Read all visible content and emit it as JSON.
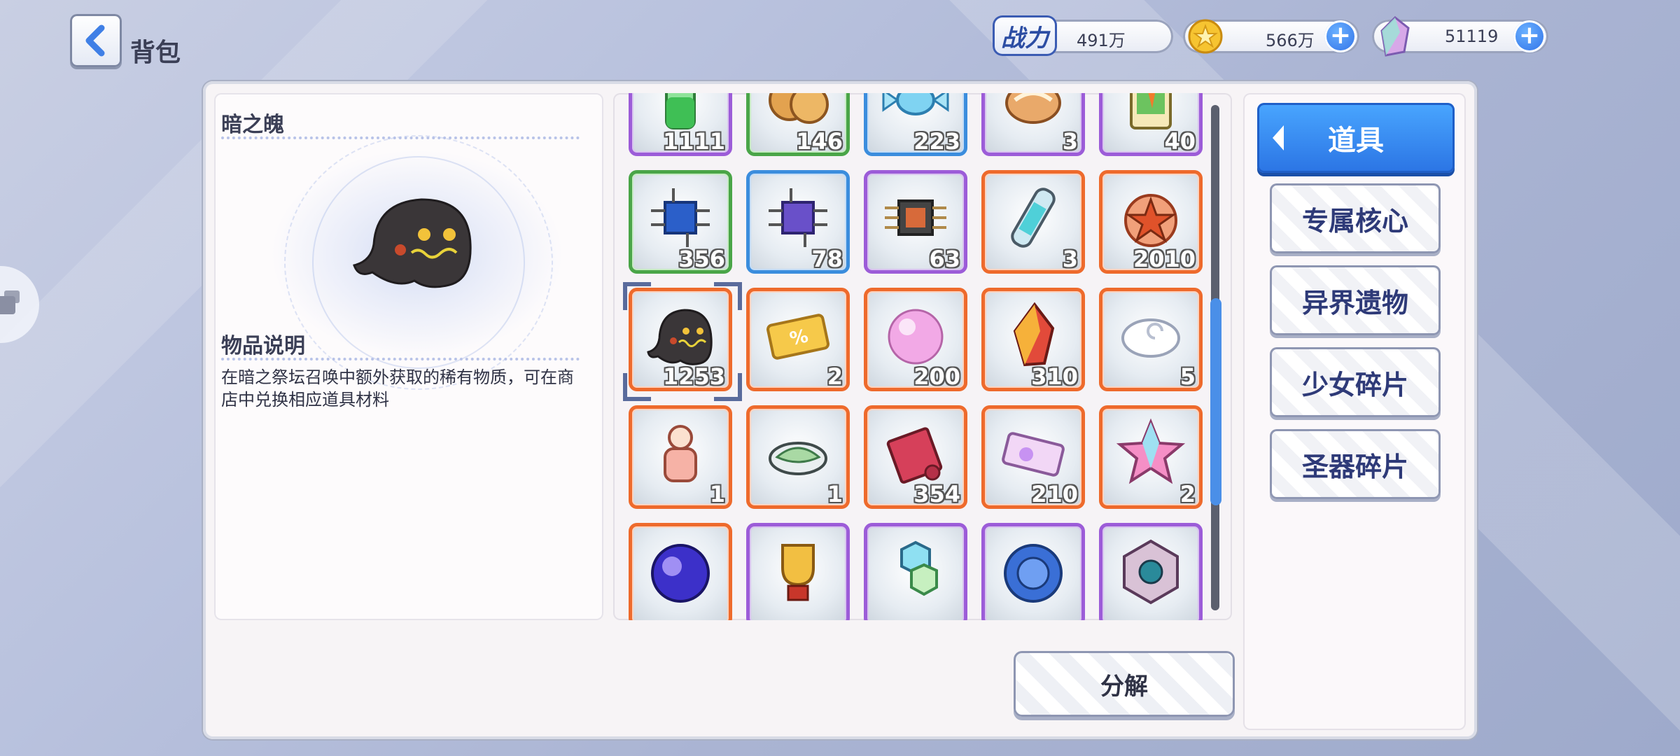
{
  "header": {
    "title": "背包"
  },
  "resources": {
    "power": {
      "label": "战力",
      "value": "491万"
    },
    "gold": {
      "value": "566万"
    },
    "crystal": {
      "value": "51119"
    }
  },
  "detail": {
    "item_name": "暗之魄",
    "section_title": "物品说明",
    "description": "在暗之祭坛召唤中额外获取的稀有物质，可在商店中兑换相应道具材料"
  },
  "items": [
    {
      "count": "1111",
      "rarity": "purple",
      "icon": "green-potion-icon"
    },
    {
      "count": "146",
      "rarity": "green",
      "icon": "cookies-icon"
    },
    {
      "count": "223",
      "rarity": "blue",
      "icon": "candy-icon"
    },
    {
      "count": "3",
      "rarity": "purple",
      "icon": "bread-roll-icon"
    },
    {
      "count": "40",
      "rarity": "purple",
      "icon": "juice-box-icon"
    },
    {
      "count": "356",
      "rarity": "green",
      "icon": "blue-chip-icon"
    },
    {
      "count": "78",
      "rarity": "blue",
      "icon": "purple-chip-icon"
    },
    {
      "count": "63",
      "rarity": "purple",
      "icon": "circuit-chip-icon"
    },
    {
      "count": "3",
      "rarity": "orange",
      "icon": "energy-tube-icon"
    },
    {
      "count": "2010",
      "rarity": "orange",
      "icon": "star-medal-icon"
    },
    {
      "count": "1253",
      "rarity": "orange",
      "icon": "dark-ghost-icon",
      "selected": true
    },
    {
      "count": "2",
      "rarity": "orange",
      "icon": "discount-ticket-icon"
    },
    {
      "count": "200",
      "rarity": "orange",
      "icon": "pink-orb-icon"
    },
    {
      "count": "310",
      "rarity": "orange",
      "icon": "fire-crystal-icon"
    },
    {
      "count": "5",
      "rarity": "orange",
      "icon": "cloud-swirl-icon"
    },
    {
      "count": "1",
      "rarity": "orange",
      "icon": "pink-jar-icon"
    },
    {
      "count": "1",
      "rarity": "orange",
      "icon": "leaf-plate-icon"
    },
    {
      "count": "354",
      "rarity": "orange",
      "icon": "red-scroll-icon"
    },
    {
      "count": "210",
      "rarity": "orange",
      "icon": "ticket-icon"
    },
    {
      "count": "2",
      "rarity": "orange",
      "icon": "pink-star-gem-icon"
    },
    {
      "count": "",
      "rarity": "orange",
      "icon": "galaxy-orb-icon"
    },
    {
      "count": "",
      "rarity": "purple",
      "icon": "trophy-icon"
    },
    {
      "count": "",
      "rarity": "purple",
      "icon": "crystal-cluster-icon"
    },
    {
      "count": "",
      "rarity": "purple",
      "icon": "blue-coin-icon"
    },
    {
      "count": "",
      "rarity": "purple",
      "icon": "hex-badge-icon"
    }
  ],
  "categories": {
    "active": "道具",
    "others": [
      "专属核心",
      "异界遗物",
      "少女碎片",
      "圣器碎片"
    ]
  },
  "actions": {
    "decompose": "分解"
  },
  "colors": {
    "purple": "#9c5cd8",
    "green": "#4aa548",
    "blue": "#3b8ddd",
    "orange": "#ee6a2c",
    "accent": "#2b74e4"
  }
}
